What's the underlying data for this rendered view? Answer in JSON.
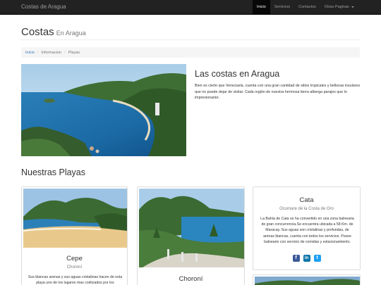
{
  "navbar": {
    "brand": "Costas de Aragua",
    "items": [
      {
        "label": "Inicio",
        "active": true
      },
      {
        "label": "Servicios",
        "active": false
      },
      {
        "label": "Contactos",
        "active": false
      },
      {
        "label": "Otras Paginas",
        "active": false,
        "dropdown": true
      }
    ]
  },
  "header": {
    "title": "Costas",
    "subtitle": "En Aragua"
  },
  "breadcrumb": [
    "Inicio",
    "Informacion",
    "Playas"
  ],
  "hero": {
    "title": "Las costas en Aragua",
    "text": "Bien es cierto que Venezuela, cuenta con una gran cantidad de sitios tropicales y bellezas insulares que no puede dejar de visitar. Cada región de nuestra hermosa tierra alberga parajes que lo impresionarán."
  },
  "section_title": "Nuestras Playas",
  "cards": [
    {
      "title": "Cepe",
      "subtitle": "Choroní",
      "text": "Sus blancas arenas y sus aguas cristalinas hacen de esta playa uno de los lugares mas codiciados por los"
    },
    {
      "title": "Choroní"
    },
    {
      "title": "Cata",
      "subtitle": "Ocumare de la Costa de Oro",
      "text": "La Bahía de Cata se ha convertido en una zona balnearia de gran concurrencia.Se encuentra ubicada a 58 Km. de Maracay. Sus aguas son cristalinas y profundas, de arenas blancas, cuenta con todos los servicios. Posee balneario con servicio de comidas y estacionamiento."
    }
  ],
  "social_icons": [
    "facebook-icon",
    "linkedin-icon",
    "twitter-icon"
  ],
  "colors": {
    "navbar": "#222222",
    "link": "#337ab7",
    "social": "#3b5998"
  }
}
